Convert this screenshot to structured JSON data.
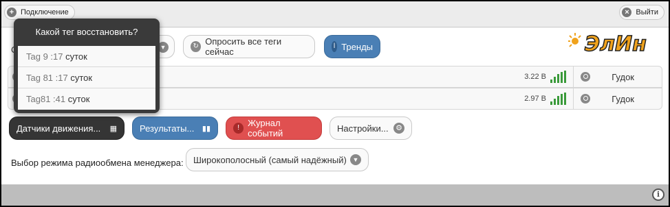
{
  "topbar": {
    "connect_label": "Подключение",
    "logout_label": "Выйти"
  },
  "toolbar": {
    "poll_label": "Опросить все теги сейчас",
    "trends_label": "Тренды",
    "partial_label": "С"
  },
  "rows": [
    {
      "voltage": "3.22 В",
      "action": "Гудок"
    },
    {
      "voltage": "2.97 В",
      "action": "Гудок"
    }
  ],
  "tabs": {
    "sensors": "Датчики движения...",
    "results": "Результаты...",
    "journal": "Журнал событий",
    "settings": "Настройки..."
  },
  "mode": {
    "label": "Выбор режима радиообмена менеджера:",
    "value": "Широкополосный (самый надёжный)"
  },
  "popup": {
    "title": "Какой тег восстановить?",
    "items": [
      {
        "name": "Tag 9 :17",
        "unit": "суток"
      },
      {
        "name": "Tag 81 :17",
        "unit": "суток"
      },
      {
        "name": "Tag81 :41",
        "unit": "суток"
      }
    ]
  },
  "logo_text": "ЭлИн",
  "icons": {
    "plus": "plus-circle-icon",
    "close": "x-circle-icon",
    "info": "info-icon",
    "signal": "signal-bars-icon"
  },
  "colors": {
    "blue": "#4a7fb5",
    "red": "#e05050",
    "dark": "#353535",
    "signal": "#3a9a3a",
    "logo_orange": "#f0a21c"
  }
}
